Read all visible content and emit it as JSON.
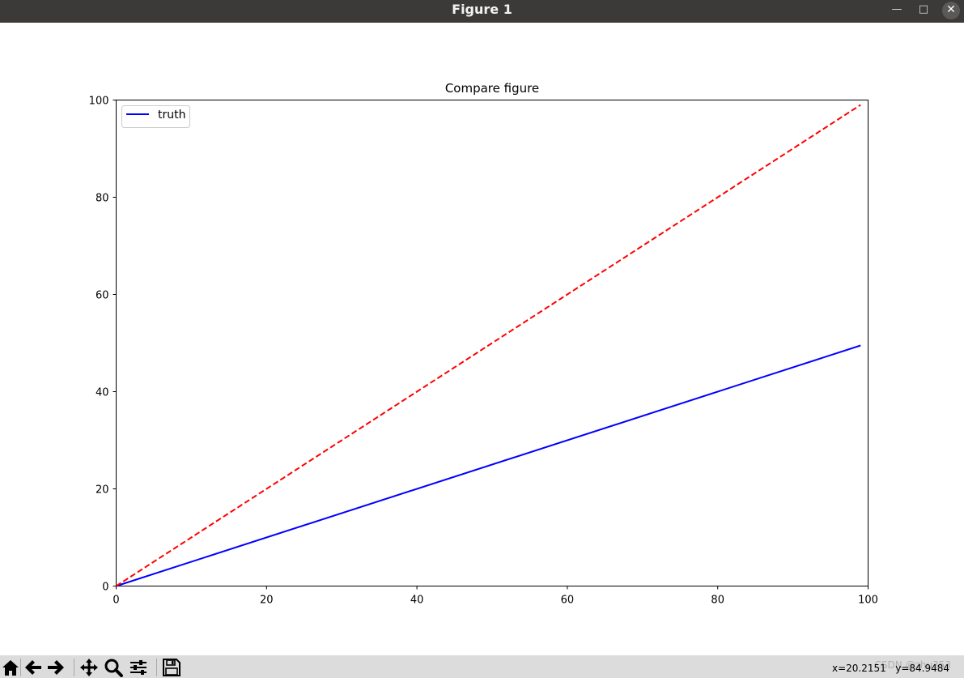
{
  "window": {
    "title": "Figure 1",
    "controls": {
      "minimize_icon": "minimize-icon",
      "maximize_icon": "maximize-icon",
      "close_icon": "close-icon"
    }
  },
  "toolbar": {
    "buttons": [
      {
        "name": "home-button",
        "icon": "home-icon"
      },
      {
        "name": "back-button",
        "icon": "arrow-left-icon"
      },
      {
        "name": "forward-button",
        "icon": "arrow-right-icon"
      },
      {
        "name": "pan-button",
        "icon": "move-icon"
      },
      {
        "name": "zoom-button",
        "icon": "magnifier-icon"
      },
      {
        "name": "configure-subplots-button",
        "icon": "sliders-icon"
      },
      {
        "name": "save-button",
        "icon": "floppy-disk-icon"
      }
    ],
    "coordinates_x": "x=20.2151",
    "coordinates_y": "y=84.9484",
    "watermark": "CSDN @zhu353"
  },
  "chart_data": {
    "type": "line",
    "title": "Compare figure",
    "xlabel": "",
    "ylabel": "",
    "xlim": [
      0,
      100
    ],
    "ylim": [
      0,
      100
    ],
    "x_ticks": [
      "0",
      "20",
      "40",
      "60",
      "80",
      "100"
    ],
    "y_ticks": [
      "0",
      "20",
      "40",
      "60",
      "80",
      "100"
    ],
    "grid": false,
    "legend": {
      "placement": "top-left",
      "entries": [
        "truth"
      ]
    },
    "series": [
      {
        "name": "truth",
        "color": "#0000ff",
        "style": "solid",
        "x": [
          0,
          99
        ],
        "y": [
          0,
          49.5
        ]
      },
      {
        "color": "#ff0000",
        "style": "dashed",
        "x": [
          0,
          99
        ],
        "y": [
          0,
          99
        ]
      }
    ]
  }
}
